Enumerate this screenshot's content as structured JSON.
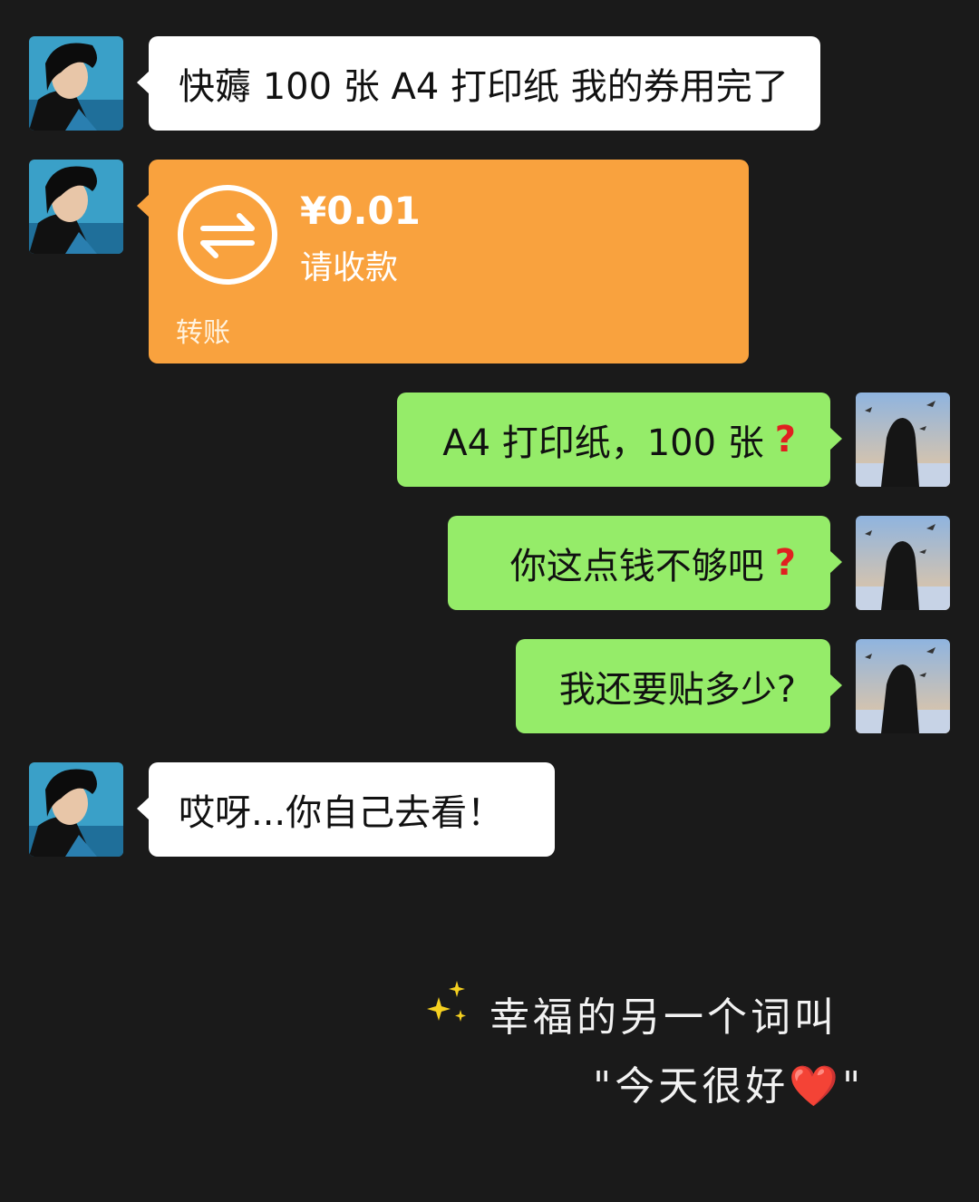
{
  "messages": [
    {
      "side": "left",
      "type": "text",
      "text": "快薅 100 张 A4 打印纸 我的券用完了"
    },
    {
      "side": "left",
      "type": "transfer",
      "amount": "¥0.01",
      "status": "请收款",
      "label": "转账",
      "color": "#f9a23e"
    },
    {
      "side": "right",
      "type": "text",
      "text": "A4 打印纸，100 张",
      "mark": "?"
    },
    {
      "side": "right",
      "type": "text",
      "text": "你这点钱不够吧",
      "mark": "?"
    },
    {
      "side": "right",
      "type": "text",
      "text": "我还要贴多少?"
    },
    {
      "side": "left",
      "type": "text",
      "text": "哎呀...你自己去看！"
    }
  ],
  "caption": {
    "line1": "幸福的另一个词叫",
    "line2": "\"今天很好",
    "heart": "❤️",
    "close_quote": "\"",
    "sparkle_icon": "sparkles-icon"
  },
  "colors": {
    "background": "#1a1a1a",
    "bubble_incoming": "#ffffff",
    "bubble_outgoing": "#95ec69",
    "transfer": "#f9a23e",
    "question_mark": "#e02020"
  }
}
